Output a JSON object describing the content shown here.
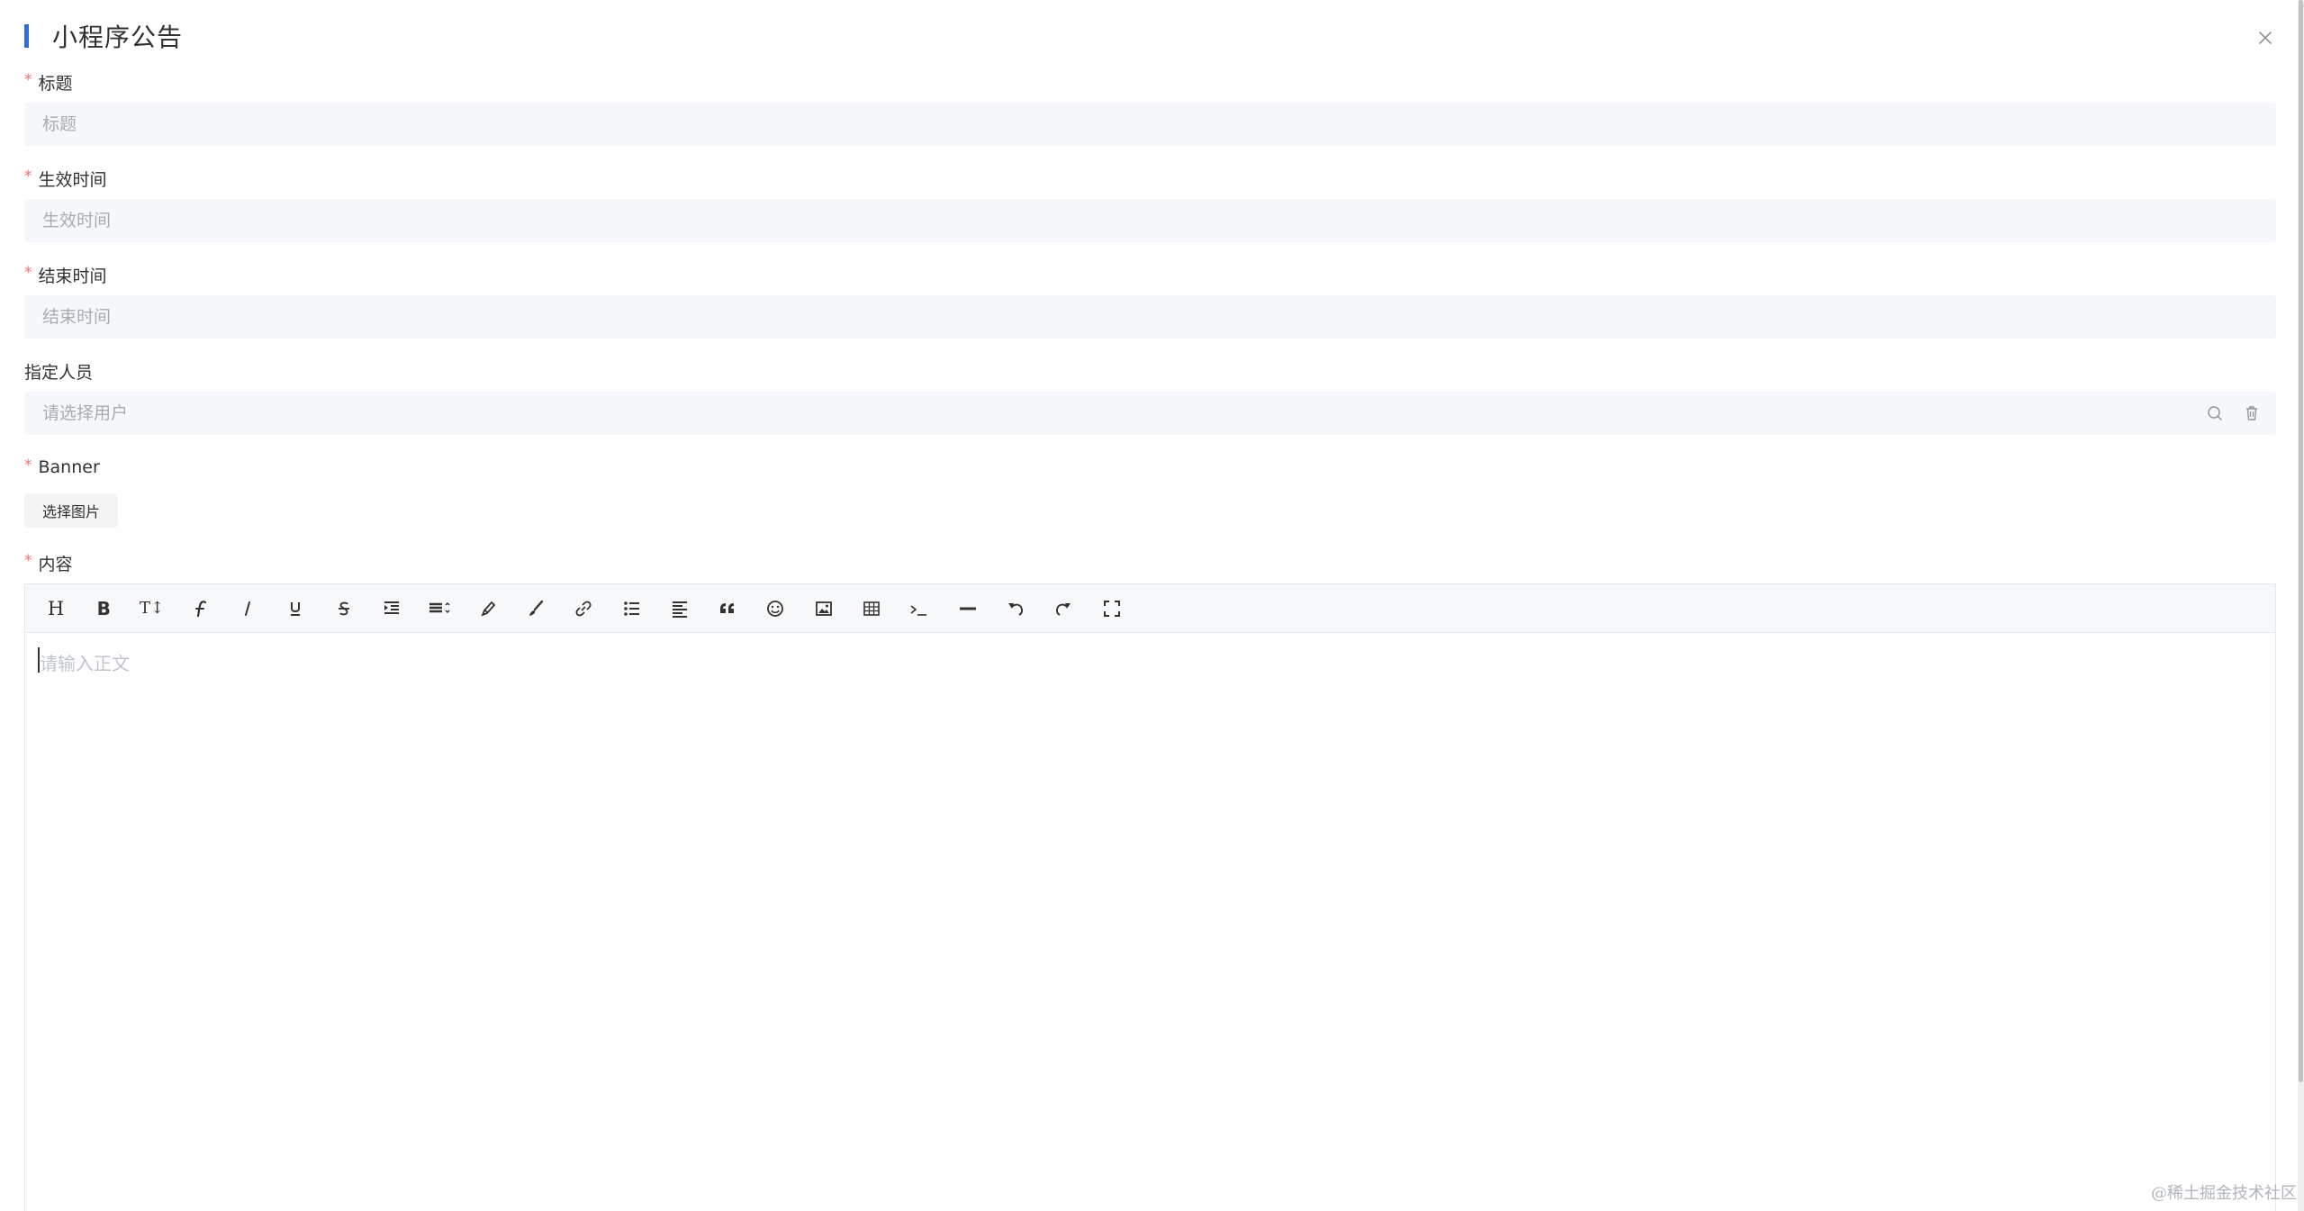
{
  "dialog": {
    "title": "小程序公告",
    "accent_color": "#2f6bdf"
  },
  "form": {
    "title": {
      "label": "标题",
      "required": "*",
      "placeholder": "标题"
    },
    "start_time": {
      "label": "生效时间",
      "required": "*",
      "placeholder": "生效时间"
    },
    "end_time": {
      "label": "结束时间",
      "required": "*",
      "placeholder": "结束时间"
    },
    "assignee": {
      "label": "指定人员",
      "placeholder": "请选择用户",
      "search_icon": "search-icon",
      "clear_icon": "trash-icon"
    },
    "banner": {
      "label": "Banner",
      "required": "*",
      "button": "选择图片"
    },
    "content": {
      "label": "内容",
      "required": "*",
      "placeholder": "请输入正文"
    }
  },
  "toolbar": {
    "heading_glyph": "H",
    "bold_glyph": "B",
    "font_size_glyph": "T↕",
    "items": [
      "heading-icon",
      "bold-icon",
      "font-size-icon",
      "font-family-icon",
      "italic-icon",
      "underline-icon",
      "strikethrough-icon",
      "indent-icon",
      "line-height-icon",
      "text-color-icon",
      "background-color-icon",
      "link-icon",
      "list-icon",
      "justify-icon",
      "quote-icon",
      "emoticon-icon",
      "image-icon",
      "table-icon",
      "code-icon",
      "divider-icon",
      "undo-icon",
      "redo-icon",
      "fullscreen-icon"
    ]
  },
  "watermark": "@稀土掘金技术社区",
  "colors": {
    "required": "#f56c6c",
    "input_bg": "#f5f7fa",
    "placeholder": "#a8abb2"
  }
}
